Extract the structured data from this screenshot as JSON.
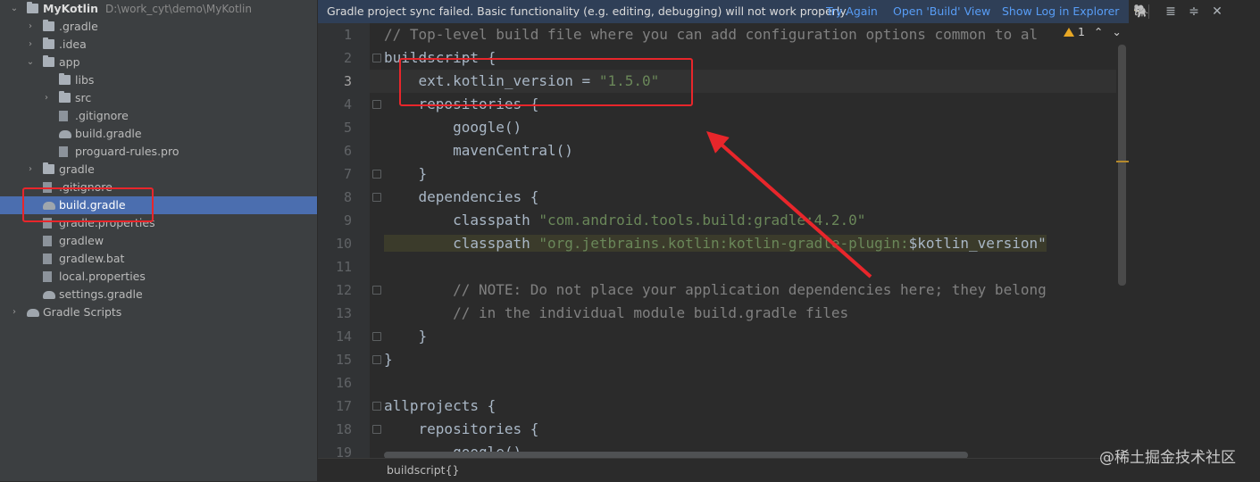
{
  "tree": {
    "items": [
      {
        "label": "MyKotlin",
        "path": "D:\\work_cyt\\demo\\MyKotlin",
        "icon": "project-folder-icon",
        "arrow": "expanded"
      },
      {
        "label": ".gradle",
        "icon": "folder-icon",
        "arrow": "collapsed"
      },
      {
        "label": ".idea",
        "icon": "folder-icon",
        "arrow": "collapsed"
      },
      {
        "label": "app",
        "icon": "folder-icon",
        "arrow": "expanded"
      },
      {
        "label": "libs",
        "icon": "folder-icon",
        "arrow": "none"
      },
      {
        "label": "src",
        "icon": "folder-icon",
        "arrow": "collapsed"
      },
      {
        "label": ".gitignore",
        "icon": "gitignore-file-icon",
        "arrow": "none"
      },
      {
        "label": "build.gradle",
        "icon": "gradle-file-icon",
        "arrow": "none"
      },
      {
        "label": "proguard-rules.pro",
        "icon": "file-icon",
        "arrow": "none"
      },
      {
        "label": "gradle",
        "icon": "folder-icon",
        "arrow": "collapsed"
      },
      {
        "label": ".gitignore",
        "icon": "gitignore-file-icon",
        "arrow": "none"
      },
      {
        "label": "build.gradle",
        "icon": "gradle-file-icon",
        "arrow": "none",
        "selected": true
      },
      {
        "label": "gradle.properties",
        "icon": "properties-file-icon",
        "arrow": "none"
      },
      {
        "label": "gradlew",
        "icon": "script-file-icon",
        "arrow": "none"
      },
      {
        "label": "gradlew.bat",
        "icon": "file-icon",
        "arrow": "none"
      },
      {
        "label": "local.properties",
        "icon": "properties-file-icon",
        "arrow": "none"
      },
      {
        "label": "settings.gradle",
        "icon": "gradle-file-icon",
        "arrow": "none"
      },
      {
        "label": "Gradle Scripts",
        "icon": "gradle-scripts-icon",
        "arrow": "collapsed"
      }
    ]
  },
  "notification": {
    "message": "Gradle project sync failed. Basic functionality (e.g. editing, debugging) will not work properly.",
    "try_again": "Try Again",
    "open_build": "Open 'Build' View",
    "show_log": "Show Log in Explorer"
  },
  "inspection": {
    "count": "1"
  },
  "editor": {
    "lines": [
      {
        "n": "1",
        "text": "// Top-level build file where you can add configuration options common to al",
        "kind": "comment"
      },
      {
        "n": "2",
        "text": "buildscript {",
        "kind": "plain"
      },
      {
        "n": "3",
        "prefix": "    ext.kotlin_version = ",
        "string": "\"1.5.0\"",
        "kind": "assign",
        "current": true
      },
      {
        "n": "4",
        "text": "    repositories {",
        "kind": "plain"
      },
      {
        "n": "5",
        "text": "        google()",
        "kind": "plain"
      },
      {
        "n": "6",
        "text": "        mavenCentral()",
        "kind": "plain"
      },
      {
        "n": "7",
        "text": "    }",
        "kind": "plain"
      },
      {
        "n": "8",
        "text": "    dependencies {",
        "kind": "plain"
      },
      {
        "n": "9",
        "prefix": "        classpath ",
        "string": "\"com.android.tools.build:gradle:4.2.0\"",
        "kind": "assign"
      },
      {
        "n": "10",
        "prefix": "        classpath ",
        "string": "\"org.jetbrains.kotlin:kotlin-gradle-plugin:",
        "tail": "$kotlin_version\"",
        "kind": "assign",
        "highlight": true
      },
      {
        "n": "11",
        "text": "",
        "kind": "plain"
      },
      {
        "n": "12",
        "text": "        // NOTE: Do not place your application dependencies here; they belong",
        "kind": "comment"
      },
      {
        "n": "13",
        "text": "        // in the individual module build.gradle files",
        "kind": "comment"
      },
      {
        "n": "14",
        "text": "    }",
        "kind": "plain"
      },
      {
        "n": "15",
        "text": "}",
        "kind": "plain"
      },
      {
        "n": "16",
        "text": "",
        "kind": "plain"
      },
      {
        "n": "17",
        "text": "allprojects {",
        "kind": "plain"
      },
      {
        "n": "18",
        "text": "    repositories {",
        "kind": "plain"
      },
      {
        "n": "19",
        "text": "        google()",
        "kind": "plain"
      }
    ]
  },
  "breadcrumb": "buildscript{}",
  "watermark": "@稀土掘金技术社区",
  "colors": {
    "accent": "#4b6eaf",
    "annotation": "#e8262b",
    "link": "#589df6",
    "string": "#6a8759",
    "comment": "#808080"
  }
}
